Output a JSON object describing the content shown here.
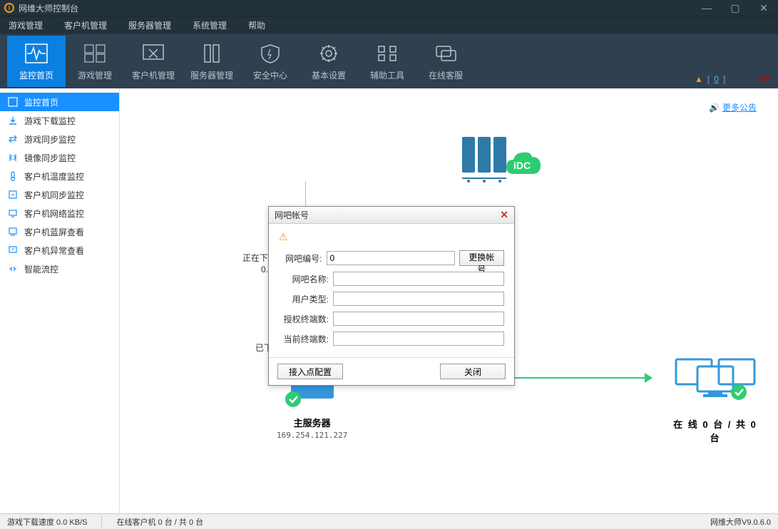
{
  "titlebar": {
    "title": "网维大师控制台"
  },
  "menu": [
    "游戏管理",
    "客户机管理",
    "服务器管理",
    "系统管理",
    "帮助"
  ],
  "toolbar": [
    {
      "label": "监控首页",
      "id": "monitor",
      "active": true
    },
    {
      "label": "游戏管理",
      "id": "game"
    },
    {
      "label": "客户机管理",
      "id": "client"
    },
    {
      "label": "服务器管理",
      "id": "server"
    },
    {
      "label": "安全中心",
      "id": "security"
    },
    {
      "label": "基本设置",
      "id": "settings"
    },
    {
      "label": "辅助工具",
      "id": "tools"
    },
    {
      "label": "在线客服",
      "id": "support"
    }
  ],
  "toolbar_status": {
    "bracket_left": "[",
    "value_link": "0",
    "bracket_right": "]",
    "vip": "VIP"
  },
  "sidebar": [
    {
      "label": "监控首页",
      "active": true,
      "icon": "activity"
    },
    {
      "label": "游戏下载监控",
      "icon": "download"
    },
    {
      "label": "游戏同步监控",
      "icon": "sync"
    },
    {
      "label": "镜像同步监控",
      "icon": "mirror"
    },
    {
      "label": "客户机温度监控",
      "icon": "thermo"
    },
    {
      "label": "客户机同步监控",
      "icon": "sync2"
    },
    {
      "label": "客户机网络监控",
      "icon": "network"
    },
    {
      "label": "客户机蓝屏查看",
      "icon": "bluescreen"
    },
    {
      "label": "客户机异常查看",
      "icon": "error"
    },
    {
      "label": "智能流控",
      "icon": "flow"
    }
  ],
  "announce": "更多公告",
  "diagram": {
    "downloading_label": "正在下载 0 个",
    "downloading_speed": "0.0 KB/S",
    "downloaded_label": "已下载0个(",
    "server_label": "主服务器",
    "server_ip": "169.254.121.227",
    "idc_badge": "iDC",
    "client_status": "在 线 0 台 / 共 0 台"
  },
  "dialog": {
    "title": "网吧帐号",
    "fields": {
      "id_label": "网吧编号:",
      "id_value": "0",
      "change_btn": "更换帐号",
      "name_label": "网吧名称:",
      "name_value": "",
      "type_label": "用户类型:",
      "type_value": "",
      "auth_label": "授权终端数:",
      "auth_value": "",
      "curr_label": "当前终端数:",
      "curr_value": ""
    },
    "btn_config": "接入点配置",
    "btn_close": "关闭"
  },
  "statusbar": {
    "speed": "游戏下载速度 0.0 KB/S",
    "clients": "在线客户机 0 台 / 共 0 台",
    "version": "网维大师V9.0.6.0"
  }
}
